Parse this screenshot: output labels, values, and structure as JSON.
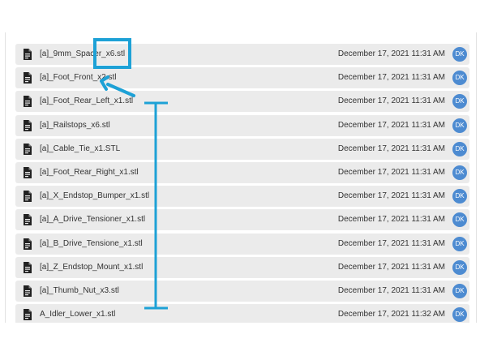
{
  "files": [
    {
      "name": "[a]_9mm_Spacer_x6.stl",
      "date": "December 17, 2021 11:31 AM",
      "avatar": "DK",
      "icon": "document-icon"
    },
    {
      "name": "[a]_Foot_Front_x2.stl",
      "date": "December 17, 2021 11:31 AM",
      "avatar": "DK",
      "icon": "document-icon"
    },
    {
      "name": "[a]_Foot_Rear_Left_x1.stl",
      "date": "December 17, 2021 11:31 AM",
      "avatar": "DK",
      "icon": "document-icon"
    },
    {
      "name": "[a]_Railstops_x6.stl",
      "date": "December 17, 2021 11:31 AM",
      "avatar": "DK",
      "icon": "document-icon"
    },
    {
      "name": "[a]_Cable_Tie_x1.STL",
      "date": "December 17, 2021 11:31 AM",
      "avatar": "DK",
      "icon": "document-icon"
    },
    {
      "name": "[a]_Foot_Rear_Right_x1.stl",
      "date": "December 17, 2021 11:31 AM",
      "avatar": "DK",
      "icon": "document-icon"
    },
    {
      "name": "[a]_X_Endstop_Bumper_x1.stl",
      "date": "December 17, 2021 11:31 AM",
      "avatar": "DK",
      "icon": "document-icon"
    },
    {
      "name": "[a]_A_Drive_Tensioner_x1.stl",
      "date": "December 17, 2021 11:31 AM",
      "avatar": "DK",
      "icon": "document-icon"
    },
    {
      "name": "[a]_B_Drive_Tensione_x1.stl",
      "date": "December 17, 2021 11:31 AM",
      "avatar": "DK",
      "icon": "document-icon"
    },
    {
      "name": "[a]_Z_Endstop_Mount_x1.stl",
      "date": "December 17, 2021 11:31 AM",
      "avatar": "DK",
      "icon": "document-icon"
    },
    {
      "name": "[a]_Thumb_Nut_x3.stl",
      "date": "December 17, 2021 11:31 AM",
      "avatar": "DK",
      "icon": "document-icon"
    },
    {
      "name": "A_Idler_Lower_x1.stl",
      "date": "December 17, 2021 11:32 AM",
      "avatar": "DK",
      "icon": "document-icon"
    }
  ],
  "colors": {
    "row_bg": "#ebebeb",
    "avatar_bg": "#4d8bd1",
    "annotation": "#1da1d6"
  },
  "annotations": [
    {
      "type": "highlight-box",
      "target_file": "[a]_9mm_Spacer_x6.stl"
    },
    {
      "type": "arrow",
      "target_file": "[a]_Foot_Front_x2.stl"
    },
    {
      "type": "range-bracket",
      "from_file": "[a]_Foot_Rear_Left_x1.stl",
      "to_file": "A_Idler_Lower_x1.stl"
    }
  ]
}
